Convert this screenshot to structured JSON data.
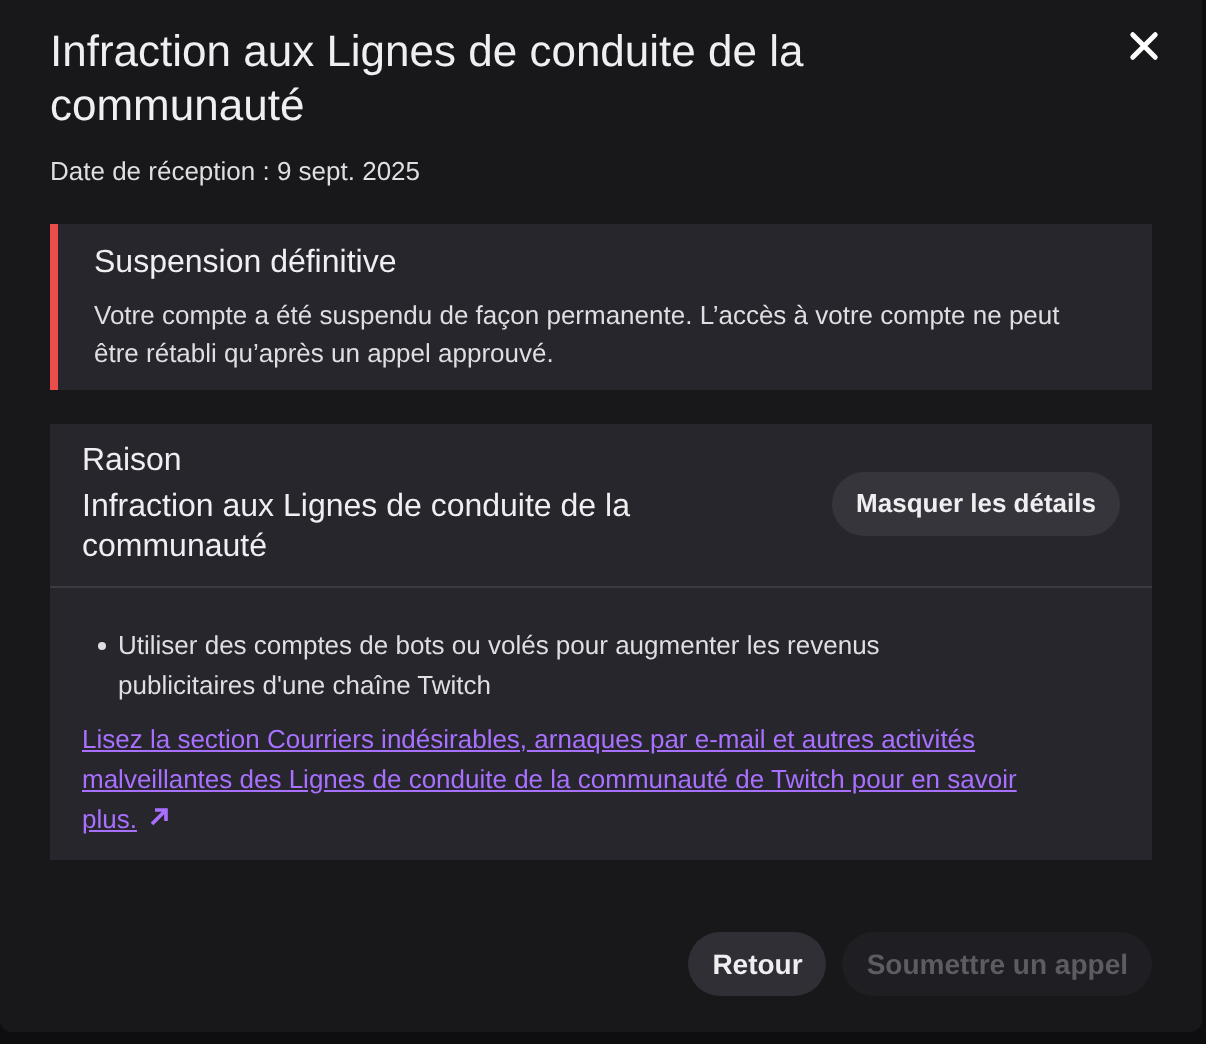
{
  "dialog": {
    "title": "Infraction aux Lignes de conduite de la communauté",
    "received": "Date de réception : 9 sept. 2025"
  },
  "alert": {
    "title": "Suspension définitive",
    "body": "Votre compte a été suspendu de façon permanente. L’accès à votre compte ne peut être rétabli qu’après un appel approuvé."
  },
  "reason": {
    "label": "Raison",
    "value": "Infraction aux Lignes de conduite de la communauté",
    "toggle": "Masquer les détails",
    "expanded": true,
    "bullets": [
      "Utiliser des comptes de bots ou volés pour augmenter les revenus publicitaires d'une chaîne Twitch"
    ],
    "link": "Lisez la section Courriers indésirables, arnaques par e-mail et autres activités malveillantes des Lignes de conduite de la communauté de Twitch pour en savoir plus."
  },
  "buttons": [
    {
      "label": "Retour",
      "disabled": false
    },
    {
      "label": "Soumettre un appel",
      "disabled": true
    }
  ]
}
